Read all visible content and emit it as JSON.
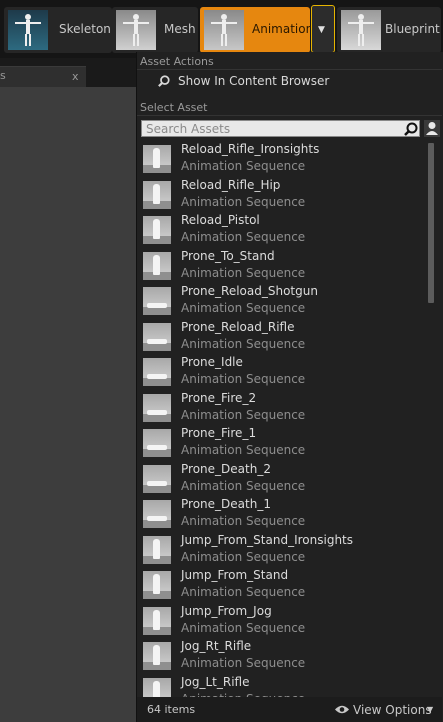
{
  "toolbar": {
    "modes": [
      {
        "id": "skeleton",
        "label": "Skeleton"
      },
      {
        "id": "mesh",
        "label": "Mesh"
      },
      {
        "id": "animation",
        "label": "Animation"
      },
      {
        "id": "blueprint",
        "label": "Blueprint"
      }
    ],
    "active_mode": "animation",
    "dropdown_icon": "chevron-down-icon",
    "accent_color": "#e6870f"
  },
  "left_panel": {
    "tab_close_glyph": "x",
    "tab_edge_glyph": "s"
  },
  "menu": {
    "asset_actions_heading": "Asset Actions",
    "show_in_browser_label": "Show In Content Browser",
    "select_asset_heading": "Select Asset",
    "search_placeholder": "Search Assets",
    "assets": [
      {
        "name": "Reload_Rifle_Ironsights",
        "type": "Animation Sequence",
        "pose": "stand"
      },
      {
        "name": "Reload_Rifle_Hip",
        "type": "Animation Sequence",
        "pose": "stand"
      },
      {
        "name": "Reload_Pistol",
        "type": "Animation Sequence",
        "pose": "stand"
      },
      {
        "name": "Prone_To_Stand",
        "type": "Animation Sequence",
        "pose": "stand"
      },
      {
        "name": "Prone_Reload_Shotgun",
        "type": "Animation Sequence",
        "pose": "prone"
      },
      {
        "name": "Prone_Reload_Rifle",
        "type": "Animation Sequence",
        "pose": "prone"
      },
      {
        "name": "Prone_Idle",
        "type": "Animation Sequence",
        "pose": "prone"
      },
      {
        "name": "Prone_Fire_2",
        "type": "Animation Sequence",
        "pose": "prone"
      },
      {
        "name": "Prone_Fire_1",
        "type": "Animation Sequence",
        "pose": "prone"
      },
      {
        "name": "Prone_Death_2",
        "type": "Animation Sequence",
        "pose": "prone"
      },
      {
        "name": "Prone_Death_1",
        "type": "Animation Sequence",
        "pose": "prone"
      },
      {
        "name": "Jump_From_Stand_Ironsights",
        "type": "Animation Sequence",
        "pose": "stand"
      },
      {
        "name": "Jump_From_Stand",
        "type": "Animation Sequence",
        "pose": "stand"
      },
      {
        "name": "Jump_From_Jog",
        "type": "Animation Sequence",
        "pose": "stand"
      },
      {
        "name": "Jog_Rt_Rifle",
        "type": "Animation Sequence",
        "pose": "stand"
      },
      {
        "name": "Jog_Lt_Rifle",
        "type": "Animation Sequence",
        "pose": "stand"
      }
    ],
    "item_count": "64 items",
    "view_options_label": "View Options"
  }
}
